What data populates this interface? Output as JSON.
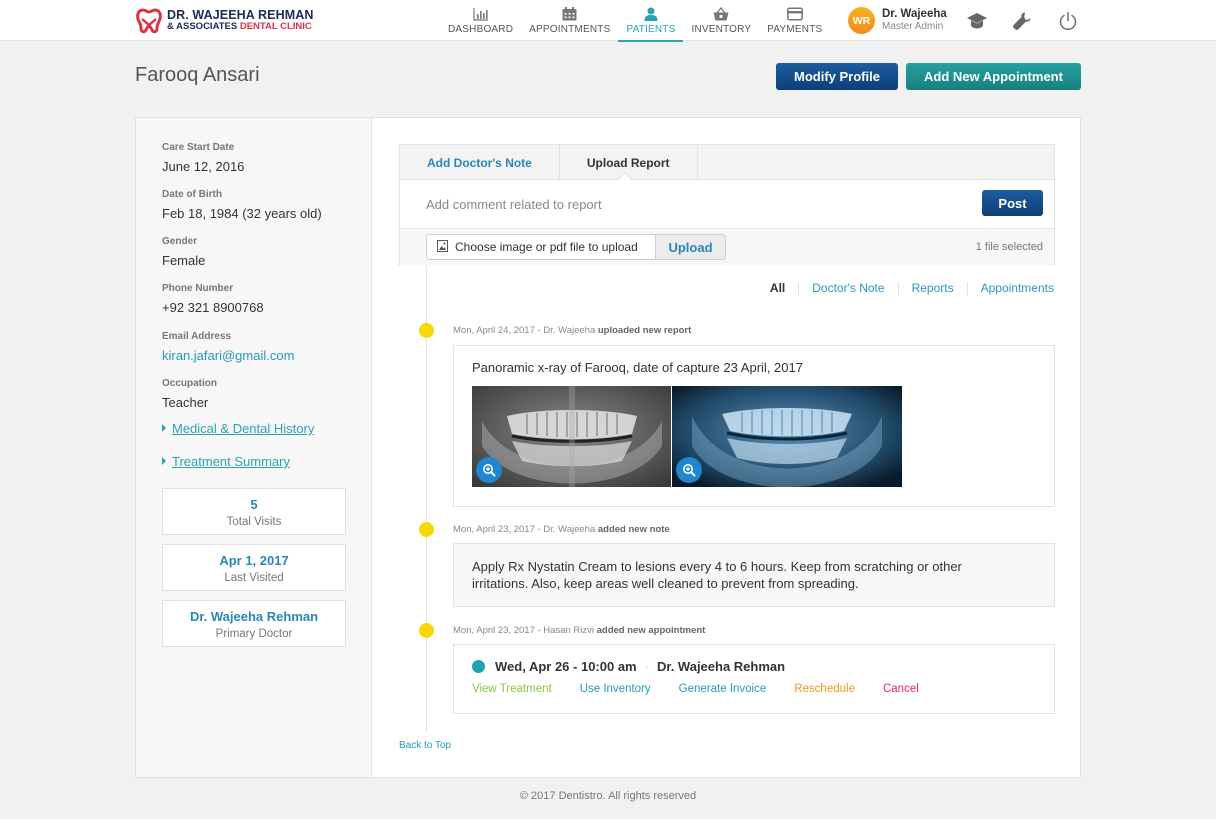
{
  "brand": {
    "line1": "DR. WAJEEHA REHMAN",
    "line2_prefix": "& ASSOCIATES ",
    "line2_accent": "DENTAL CLINIC",
    "accent_color": "#e03045",
    "primary_color": "#1d2a5a"
  },
  "nav": {
    "items": [
      {
        "label": "DASHBOARD",
        "icon": "bar-chart-icon"
      },
      {
        "label": "APPOINTMENTS",
        "icon": "calendar-icon"
      },
      {
        "label": "PATIENTS",
        "icon": "user-icon",
        "active": true
      },
      {
        "label": "INVENTORY",
        "icon": "basket-icon"
      },
      {
        "label": "PAYMENTS",
        "icon": "credit-card-icon"
      }
    ],
    "active_color": "#2aa3b4"
  },
  "user": {
    "initials": "WR",
    "name": "Dr. Wajeeha",
    "role": "Master Admin"
  },
  "header_icons": [
    "graduation-cap-icon",
    "wrench-icon",
    "power-icon"
  ],
  "page": {
    "title": "Farooq Ansari",
    "modify_label": "Modify Profile",
    "add_appointment_label": "Add New Appointment"
  },
  "patient": {
    "fields": [
      {
        "label": "Care Start Date",
        "value": "June 12, 2016"
      },
      {
        "label": "Date of Birth",
        "value": "Feb 18, 1984 (32 years old)"
      },
      {
        "label": "Gender",
        "value": "Female"
      },
      {
        "label": "Phone Number",
        "value": "+92 321 8900768"
      },
      {
        "label": "Email Address",
        "value": "kiran.jafari@gmail.com"
      },
      {
        "label": "Occupation",
        "value": "Teacher"
      }
    ],
    "links": [
      "Medical & Dental History",
      "Treatment Summary"
    ],
    "stats": [
      {
        "value": "5",
        "label": "Total Visits"
      },
      {
        "value": "Apr 1, 2017",
        "label": "Last Visited"
      },
      {
        "value": "Dr. Wajeeha Rehman",
        "label": "Primary Doctor"
      }
    ]
  },
  "composer": {
    "tabs": [
      {
        "label": "Add Doctor's Note"
      },
      {
        "label": "Upload Report",
        "active": true
      }
    ],
    "comment_placeholder": "Add comment related to report",
    "post_label": "Post",
    "file_picker_label": "Choose image or pdf file to upload",
    "upload_label": "Upload",
    "file_status": "1 file selected"
  },
  "filters": [
    {
      "label": "All",
      "active": true
    },
    {
      "label": "Doctor's Note"
    },
    {
      "label": "Reports"
    },
    {
      "label": "Appointments"
    }
  ],
  "timeline": [
    {
      "meta": "Mon, April 24, 2017 - Dr. Wajeeha ",
      "action": "uploaded new report",
      "title": "Panoramic x-ray of Farooq, date of capture 23 April, 2017",
      "images": [
        "panoramic-xray-grayscale",
        "panoramic-xray-blue"
      ]
    },
    {
      "meta": "Mon, April 23, 2017 - Dr. Wajeeha ",
      "action": "added new note",
      "text": "Apply Rx Nystatin Cream to lesions every 4 to 6 hours. Keep from scratching or other irritations. Also, keep areas well cleaned to prevent from spreading."
    },
    {
      "meta": "Mon, April 23, 2017 - Hasan Rizvi ",
      "action": "added new appointment",
      "when": "Wed, Apr 26 - 10:00 am",
      "separator": "·",
      "doctor": "Dr. Wajeeha Rehman",
      "actions": [
        {
          "label": "View Treatment",
          "color": "#8cc63f"
        },
        {
          "label": "Use Inventory",
          "color": "#2a97c0"
        },
        {
          "label": "Generate Invoice",
          "color": "#2a97c0"
        },
        {
          "label": "Reschedule",
          "color": "#f7941d"
        },
        {
          "label": "Cancel",
          "color": "#e8245a"
        }
      ]
    }
  ],
  "back_to_top": "Back to Top",
  "footer": "© 2017 Dentistro. All rights reserved"
}
